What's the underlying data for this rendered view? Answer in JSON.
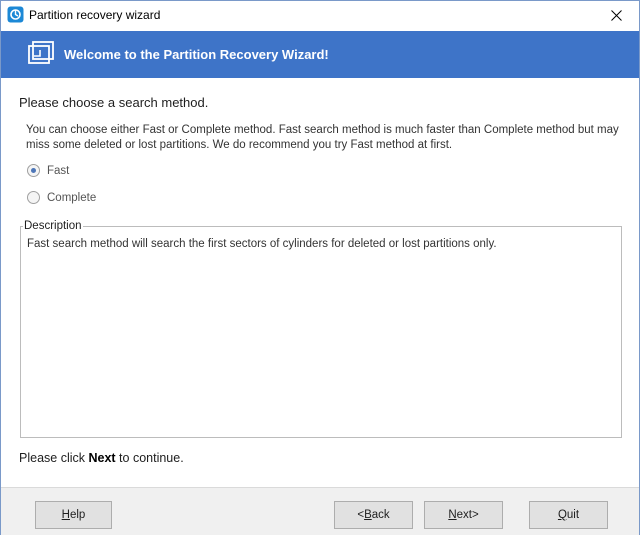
{
  "window": {
    "title": "Partition recovery wizard"
  },
  "banner": {
    "title": "Welcome to the Partition Recovery Wizard!"
  },
  "content": {
    "heading": "Please choose a search method.",
    "instruction": "You can choose either Fast or Complete method. Fast search method is much faster than Complete method but may miss some deleted or lost partitions. We do recommend you try Fast method at first.",
    "options": [
      {
        "label": "Fast",
        "selected": true
      },
      {
        "label": "Complete",
        "selected": false
      }
    ],
    "description_legend": "Description",
    "description_text": "Fast search method will search the first sectors of cylinders for deleted or lost partitions only.",
    "footer_prefix": "Please click ",
    "footer_bold": "Next",
    "footer_suffix": " to continue."
  },
  "buttons": {
    "help": {
      "label": "Help",
      "mnemonic": "H",
      "rest": "elp"
    },
    "back": {
      "label": "<Back",
      "prefix": "<",
      "mnemonic": "B",
      "rest": "ack"
    },
    "next": {
      "label": "Next>",
      "mnemonic": "N",
      "rest": "ext>"
    },
    "quit": {
      "label": "Quit",
      "mnemonic": "Q",
      "rest": "uit"
    }
  },
  "colors": {
    "banner": "#3e74c8",
    "accent": "#4e77b8"
  },
  "icons": {
    "app": "app-recovery-icon",
    "close": "close-icon",
    "banner": "wizard-window-icon"
  }
}
